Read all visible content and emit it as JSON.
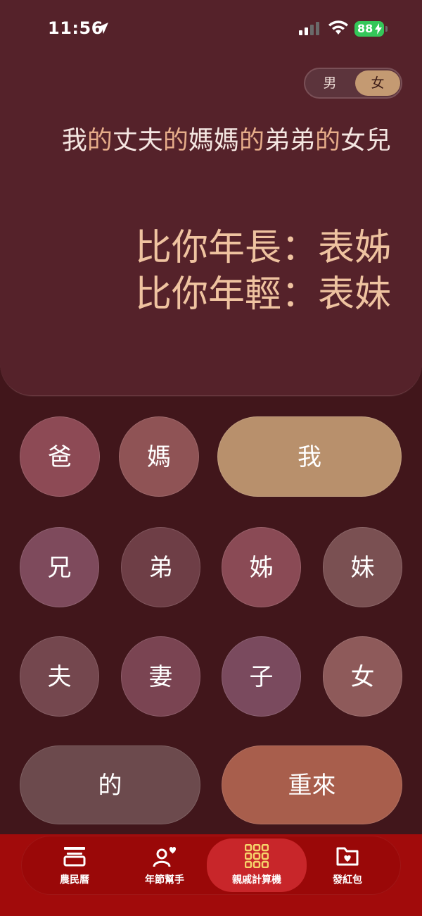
{
  "status": {
    "time": "11:56",
    "battery": "88"
  },
  "gender": {
    "options": [
      "男",
      "女"
    ],
    "selected": "女"
  },
  "expression": {
    "parts": [
      {
        "text": "我",
        "type": "term"
      },
      {
        "text": "的",
        "type": "conn"
      },
      {
        "text": "丈夫",
        "type": "term"
      },
      {
        "text": "的",
        "type": "conn"
      },
      {
        "text": "媽媽",
        "type": "term"
      },
      {
        "text": "的",
        "type": "conn"
      },
      {
        "text": "弟弟",
        "type": "term"
      },
      {
        "text": "的",
        "type": "conn"
      },
      {
        "text": "女兒",
        "type": "term"
      }
    ]
  },
  "result": {
    "older": "比你年長：表姊",
    "younger": "比你年輕：表妹"
  },
  "keys": {
    "dad": "爸",
    "mom": "媽",
    "me": "我",
    "older_brother": "兄",
    "younger_brother": "弟",
    "older_sister": "姊",
    "younger_sister": "妹",
    "husband": "夫",
    "wife": "妻",
    "son": "子",
    "daughter": "女",
    "of": "的",
    "reset": "重來"
  },
  "tabs": [
    {
      "label": "農民曆",
      "icon": "calendar-icon"
    },
    {
      "label": "年節幫手",
      "icon": "person-heart-icon"
    },
    {
      "label": "親戚計算機",
      "icon": "calculator-grid-icon",
      "active": true
    },
    {
      "label": "發紅包",
      "icon": "red-envelope-folder-icon"
    }
  ],
  "colors": {
    "display_bg": "#55222a",
    "page_bg": "#41161b",
    "accent_orange": "#efc3a0",
    "tab_bar": "#9a0808",
    "tab_active": "#c8262a"
  }
}
